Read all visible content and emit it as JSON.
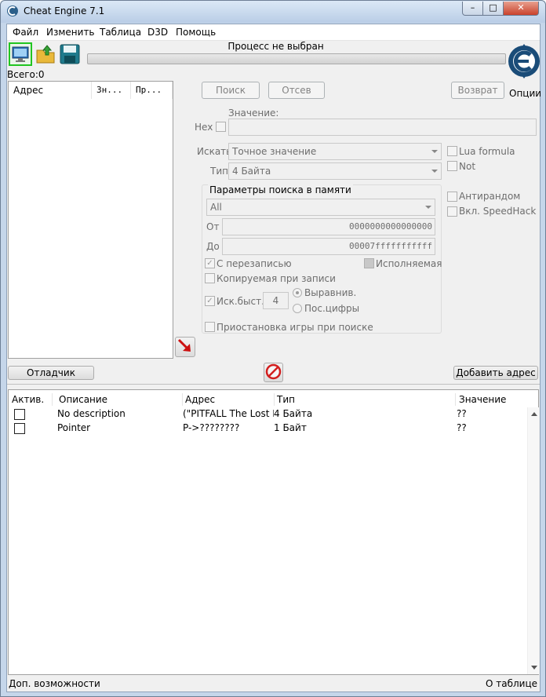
{
  "window": {
    "title": "Cheat Engine 7.1",
    "minimize": "–",
    "maximize": "□",
    "close": "✕"
  },
  "menu": [
    "Файл",
    "Изменить",
    "Таблица",
    "D3D",
    "Помощь"
  ],
  "toolbar": {
    "process_label": "Процесс не выбран",
    "options_label": "Опции",
    "icons": [
      "open-process-icon",
      "open-file-icon",
      "save-icon"
    ]
  },
  "found": {
    "label": "Всего:0",
    "columns": [
      "Адрес",
      "Зн...",
      "Пр..."
    ]
  },
  "scan": {
    "first_scan": "Поиск",
    "next_scan": "Отсев",
    "undo_scan": "Возврат",
    "value_label": "Значение:",
    "hex_label": "Hex",
    "scan_type_label": "Искать",
    "scan_type_value": "Точное значение",
    "value_type_label": "Тип",
    "value_type_value": "4 Байта",
    "lua_formula": "Lua formula",
    "not_label": "Not",
    "antirandom": "Антирандом",
    "speedhack": "Вкл. SpeedHack"
  },
  "memory_options": {
    "title": "Параметры поиска в памяти",
    "region": "All",
    "from_label": "От",
    "from_value": "0000000000000000",
    "to_label": "До",
    "to_value": "00007fffffffffff",
    "writable": "С перезаписью",
    "executable": "Исполняемая",
    "copy_on_write": "Копируемая при записи",
    "fast_scan": "Иск.быст.",
    "fast_scan_value": "4",
    "alignment": "Выравнив.",
    "last_digits": "Пос.цифры",
    "pause_game": "Приостановка игры при поиске"
  },
  "buttons": {
    "debugger": "Отладчик",
    "add_address": "Добавить адрес"
  },
  "table": {
    "columns": [
      "Актив.",
      "Описание",
      "Адрес",
      "Тип",
      "Значение"
    ],
    "rows": [
      {
        "description": "No description",
        "address": "(\"PITFALL The Lost Exp",
        "type": "4 Байта",
        "value": "??"
      },
      {
        "description": "Pointer",
        "address": "P->????????",
        "type": "1 Байт",
        "value": "??"
      }
    ]
  },
  "status": {
    "left": "Доп. возможности",
    "right": "О таблице"
  }
}
